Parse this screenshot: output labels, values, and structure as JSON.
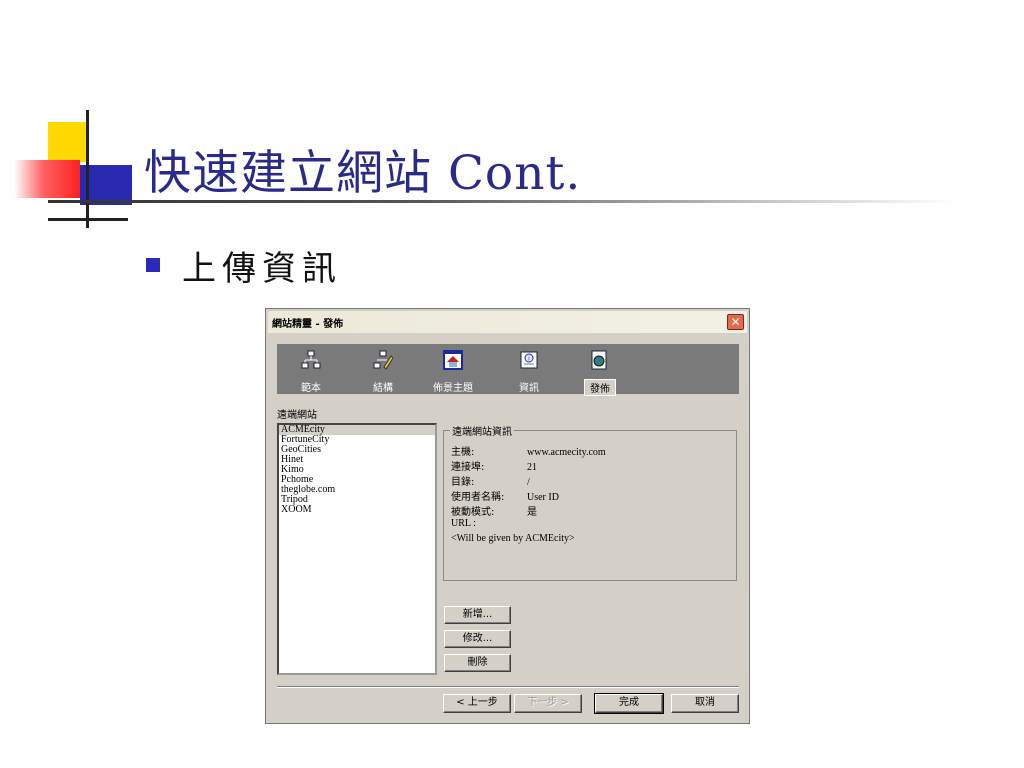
{
  "slide": {
    "title": "快速建立網站 Cont.",
    "bullet": "上傳資訊"
  },
  "dialog": {
    "title": "網站精靈 - 發佈",
    "close_glyph": "✕",
    "tabs": [
      {
        "label": "範本",
        "icon": "network-icon"
      },
      {
        "label": "結構",
        "icon": "structure-edit-icon"
      },
      {
        "label": "佈景主題",
        "icon": "theme-house-icon"
      },
      {
        "label": "資訊",
        "icon": "info-document-icon"
      },
      {
        "label": "發佈",
        "icon": "publish-globe-icon",
        "selected": true
      }
    ],
    "remote_sites_label": "遠端網站",
    "sites": [
      "ACMEcity",
      "FortuneCity",
      "GeoCities",
      "Hinet",
      "Kimo",
      "Pchome",
      "theglobe.com",
      "Tripod",
      "XOOM"
    ],
    "selected_site": "ACMEcity",
    "info_title": "遠端網站資訊",
    "info": {
      "host_label": "主機:",
      "host_value": "www.acmecity.com",
      "port_label": "連接埠:",
      "port_value": "21",
      "dir_label": "目錄:",
      "dir_value": "/",
      "user_label": "使用者名稱:",
      "user_value": "User ID",
      "passive_label": "被動模式:",
      "passive_value": "是",
      "url_label": "URL :",
      "url_value": "<Will be given by ACMEcity>"
    },
    "buttons": {
      "add": "新增...",
      "modify": "修改...",
      "delete": "刪除",
      "back": "< 上一步",
      "next": "下一步 >",
      "finish": "完成",
      "cancel": "取消"
    }
  }
}
